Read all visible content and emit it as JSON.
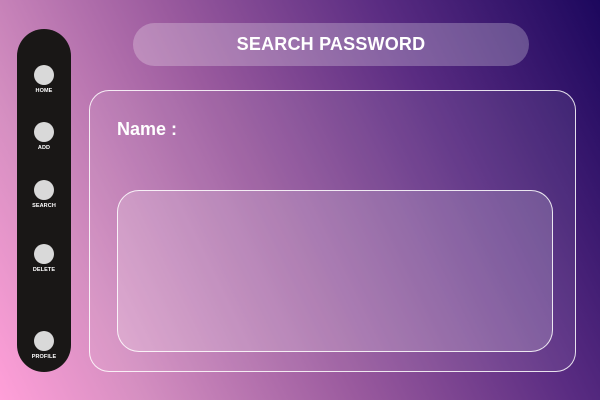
{
  "sidebar": {
    "items": [
      {
        "label": "HOME",
        "icon": "home-icon"
      },
      {
        "label": "ADD",
        "icon": "add-icon"
      },
      {
        "label": "SEARCH",
        "icon": "search-icon"
      },
      {
        "label": "DELETE",
        "icon": "delete-icon"
      },
      {
        "label": "PROFILE",
        "icon": "profile-icon"
      }
    ]
  },
  "header": {
    "title": "SEARCH PASSWORD"
  },
  "main": {
    "name_label": "Name :"
  },
  "colors": {
    "sidebar_bg": "#191716",
    "nav_dot": "#d9d9d9",
    "gradient_start": "#ff9fd8",
    "gradient_end": "#1c075d",
    "text": "#ffffff"
  }
}
